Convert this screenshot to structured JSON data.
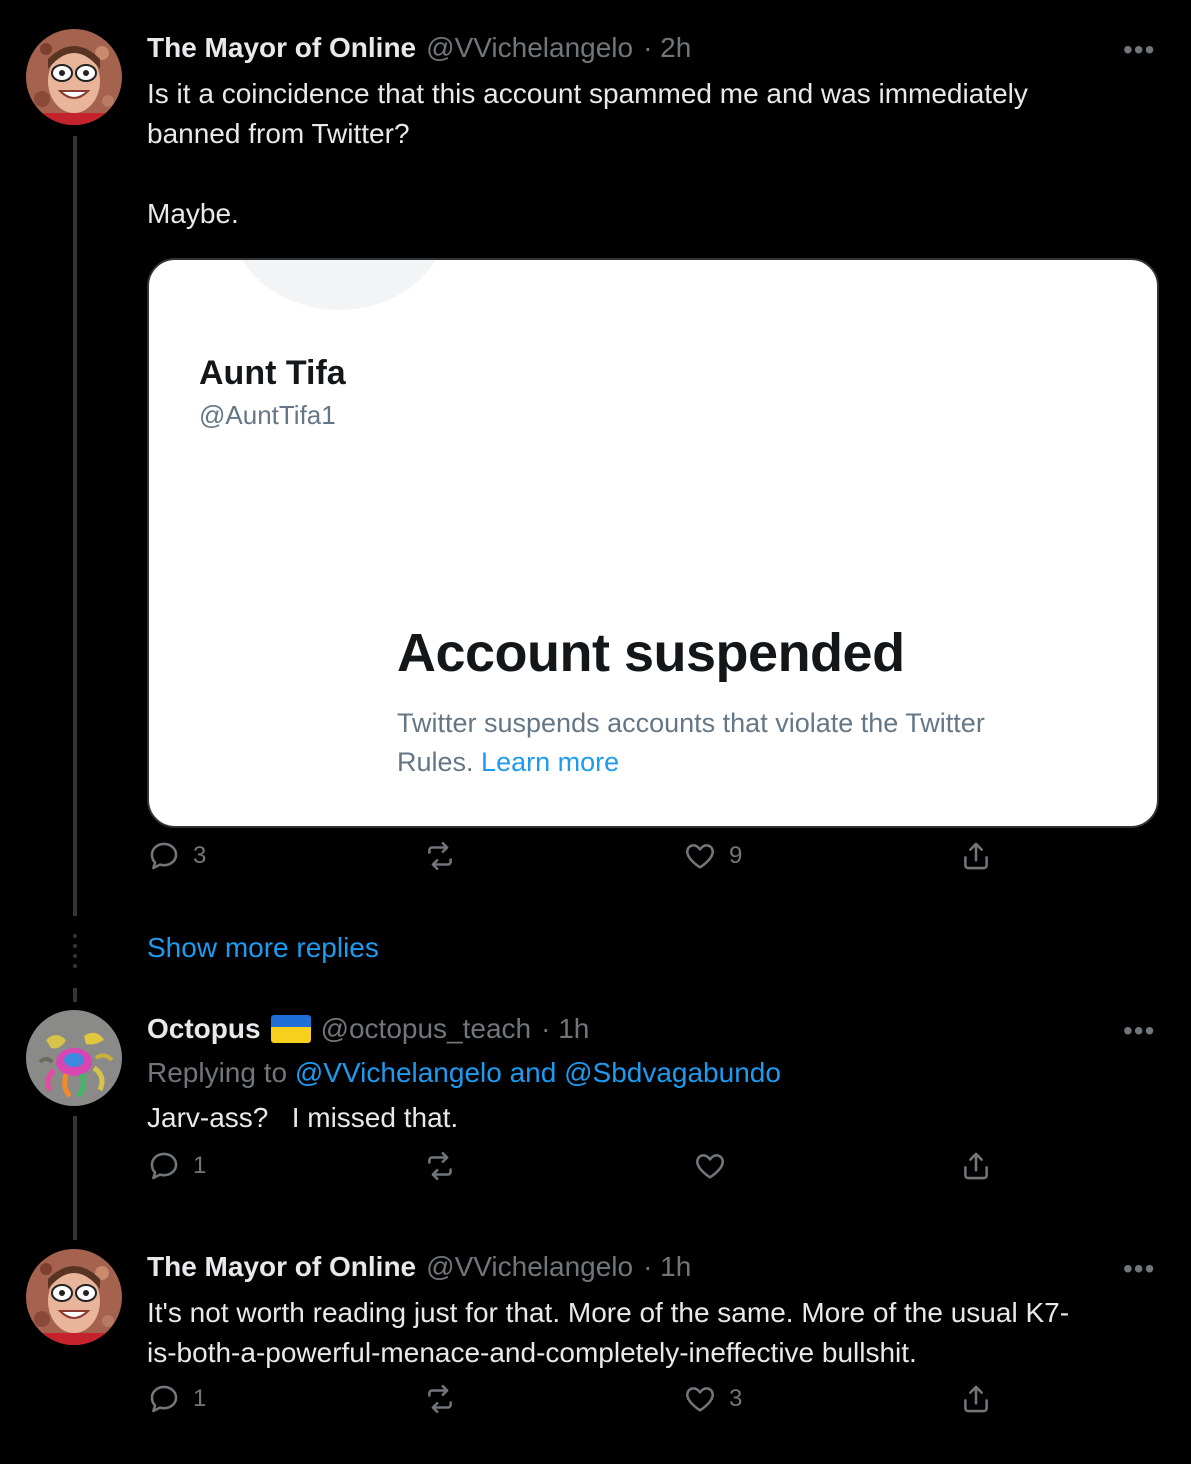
{
  "tweets": [
    {
      "name": "The Mayor of Online",
      "handle": "@VVichelangelo",
      "time": "· 2h",
      "text_line1": "Is it a coincidence that this account spammed me and was immediately",
      "text_line2": "banned from Twitter?",
      "text_line3": "Maybe.",
      "stats": {
        "replies": "3",
        "retweets": "",
        "likes": "9"
      }
    },
    {
      "name": "Octopus",
      "flag": "ukraine-flag",
      "handle": "@octopus_teach",
      "time": "· 1h",
      "replying_prefix": "Replying to",
      "replying_to": "@VVichelangelo and @Sbdvagabundo",
      "text_line1": "Jarv-ass?   I missed that.",
      "stats": {
        "replies": "1",
        "retweets": "",
        "likes": ""
      }
    },
    {
      "name": "The Mayor of Online",
      "handle": "@VVichelangelo",
      "time": "· 1h",
      "text_line1": "It's not worth reading just for that. More of the same. More of the usual K7-",
      "text_line2": "is-both-a-powerful-menace-and-completely-ineffective bullshit.",
      "stats": {
        "replies": "1",
        "retweets": "",
        "likes": "3"
      }
    }
  ],
  "embedded_image": {
    "account_name": "Aunt Tifa",
    "account_handle": "@AuntTifa1",
    "headline": "Account suspended",
    "desc_line1": "Twitter suspends accounts that violate the Twitter",
    "desc_line2": "Rules.",
    "learn_more": "Learn more"
  },
  "show_more_replies": "Show more replies",
  "more_icon_text": "•••",
  "colors": {
    "link": "#1d9bf0",
    "secondary": "#71767b",
    "background": "#000000"
  }
}
